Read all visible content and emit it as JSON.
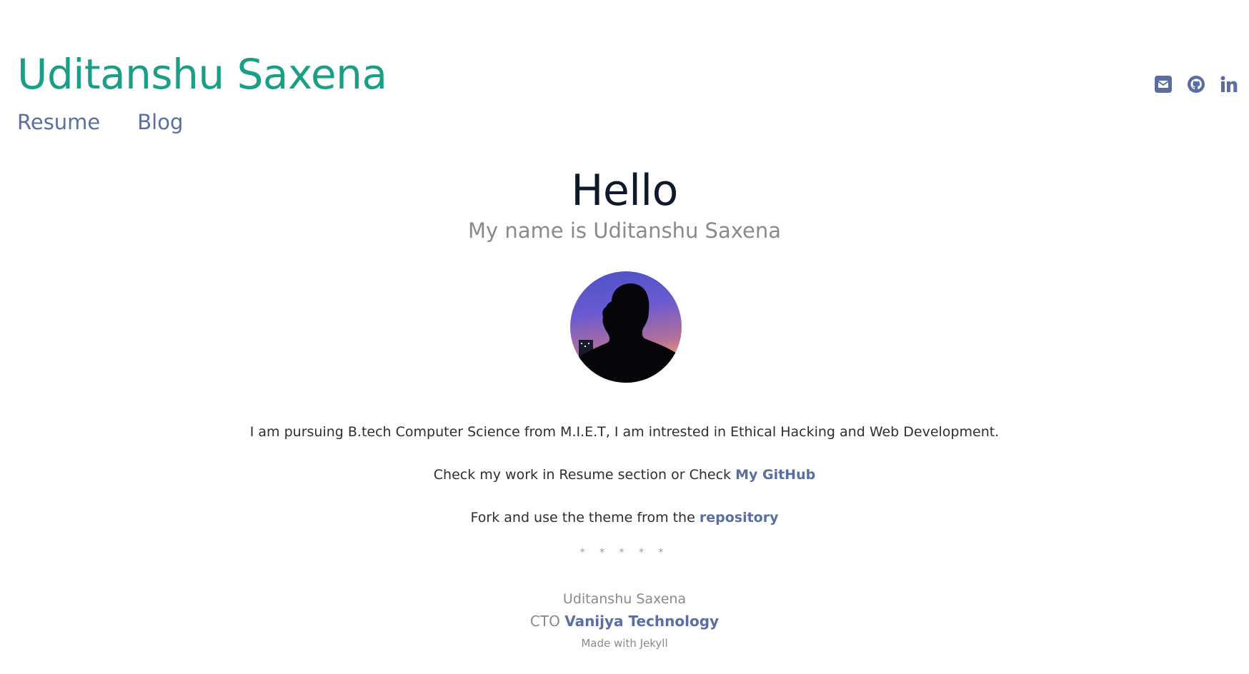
{
  "header": {
    "site_title": "Uditanshu Saxena",
    "nav": {
      "resume": "Resume",
      "blog": "Blog"
    },
    "social_icons": [
      "envelope-icon",
      "github-icon",
      "linkedin-icon"
    ]
  },
  "main": {
    "heading": "Hello",
    "subtitle": "My name is Uditanshu Saxena",
    "paragraph1": "I am pursuing B.tech Computer Science from M.I.E.T, I am intrested in Ethical Hacking and Web Development.",
    "paragraph2_text": "Check my work in Resume section or Check ",
    "paragraph2_link": "My GitHub",
    "paragraph3_text": "Fork and use the theme from the ",
    "paragraph3_link": "repository",
    "separator": "* * * * *"
  },
  "footer": {
    "name": "Uditanshu Saxena",
    "role_prefix": "CTO ",
    "company": "Vanijya Technology",
    "made_with": "Made with Jekyll"
  },
  "colors": {
    "title": "#1b9e86",
    "link": "#5a6fa0",
    "heading": "#0e1a2b",
    "muted": "#8a8a8a"
  }
}
